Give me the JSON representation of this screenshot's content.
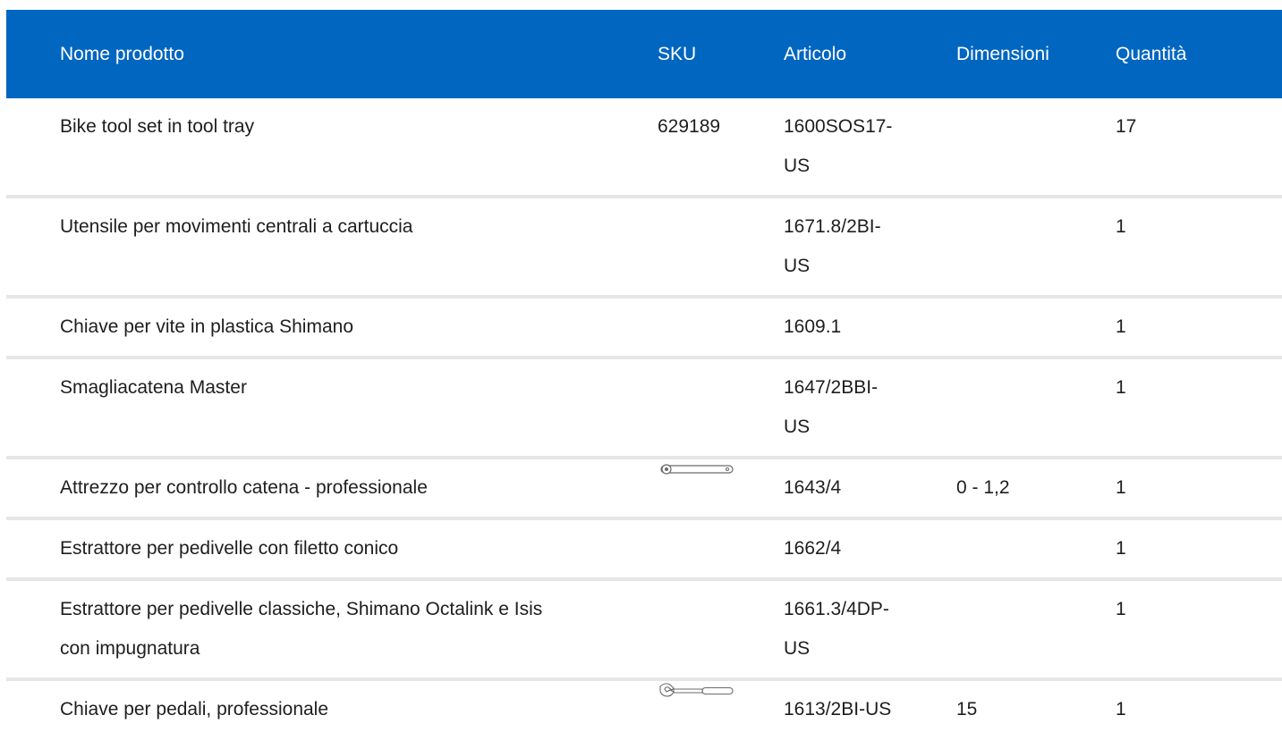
{
  "table": {
    "headers": {
      "name": "Nome prodotto",
      "sku": "SKU",
      "article": "Articolo",
      "dimensions": "Dimensioni",
      "quantity": "Quantità"
    },
    "rows": [
      {
        "name": "Bike tool set in tool tray",
        "sku": "629189",
        "article_l1": "1600SOS17-",
        "article_l2": "US",
        "dimensions": "",
        "quantity": "17",
        "image": ""
      },
      {
        "name": "Utensile per movimenti centrali a cartuccia",
        "sku": "",
        "article_l1": "1671.8/2BI-",
        "article_l2": "US",
        "dimensions": "",
        "quantity": "1",
        "image": ""
      },
      {
        "name": "Chiave per vite in plastica Shimano",
        "sku": "",
        "article_l1": "1609.1",
        "article_l2": "",
        "dimensions": "",
        "quantity": "1",
        "image": ""
      },
      {
        "name": "Smagliacatena Master",
        "sku": "",
        "article_l1": "1647/2BBI-",
        "article_l2": "US",
        "dimensions": "",
        "quantity": "1",
        "image": ""
      },
      {
        "name": "Attrezzo per controllo catena - professionale",
        "sku": "",
        "article_l1": "1643/4",
        "article_l2": "",
        "dimensions": "0 - 1,2",
        "quantity": "1",
        "image": "chain-checker-tool-image"
      },
      {
        "name": "Estrattore per pedivelle con filetto conico",
        "sku": "",
        "article_l1": "1662/4",
        "article_l2": "",
        "dimensions": "",
        "quantity": "1",
        "image": ""
      },
      {
        "name_l1": "Estrattore per pedivelle classiche, Shimano Octalink e Isis",
        "name_l2": "con impugnatura",
        "sku": "",
        "article_l1": "1661.3/4DP-",
        "article_l2": "US",
        "dimensions": "",
        "quantity": "1",
        "image": ""
      },
      {
        "name": "Chiave per pedali, professionale",
        "sku": "",
        "article_l1": "1613/2BI-US",
        "article_l2": "",
        "dimensions": "15",
        "quantity": "1",
        "image": "pedal-wrench-image"
      }
    ]
  },
  "colors": {
    "header_bg": "#0066c0",
    "header_text": "#ffffff",
    "row_divider": "#e6e6e6"
  }
}
